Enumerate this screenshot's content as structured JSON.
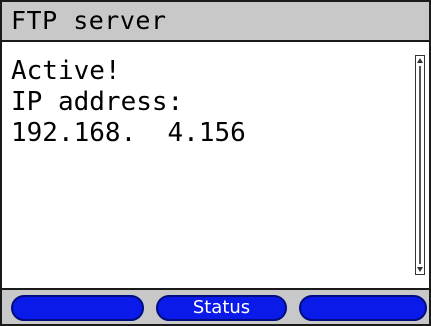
{
  "header": {
    "title": "FTP server"
  },
  "main": {
    "lines": [
      "Active!",
      "IP address:",
      "192.168.  4.156"
    ]
  },
  "softkeys": [
    {
      "label": ""
    },
    {
      "label": "Status"
    },
    {
      "label": ""
    }
  ],
  "colors": {
    "softkey_fill": "#0a1ae8",
    "bar_background": "#c8c8c8",
    "screen_background": "#ffffff"
  }
}
